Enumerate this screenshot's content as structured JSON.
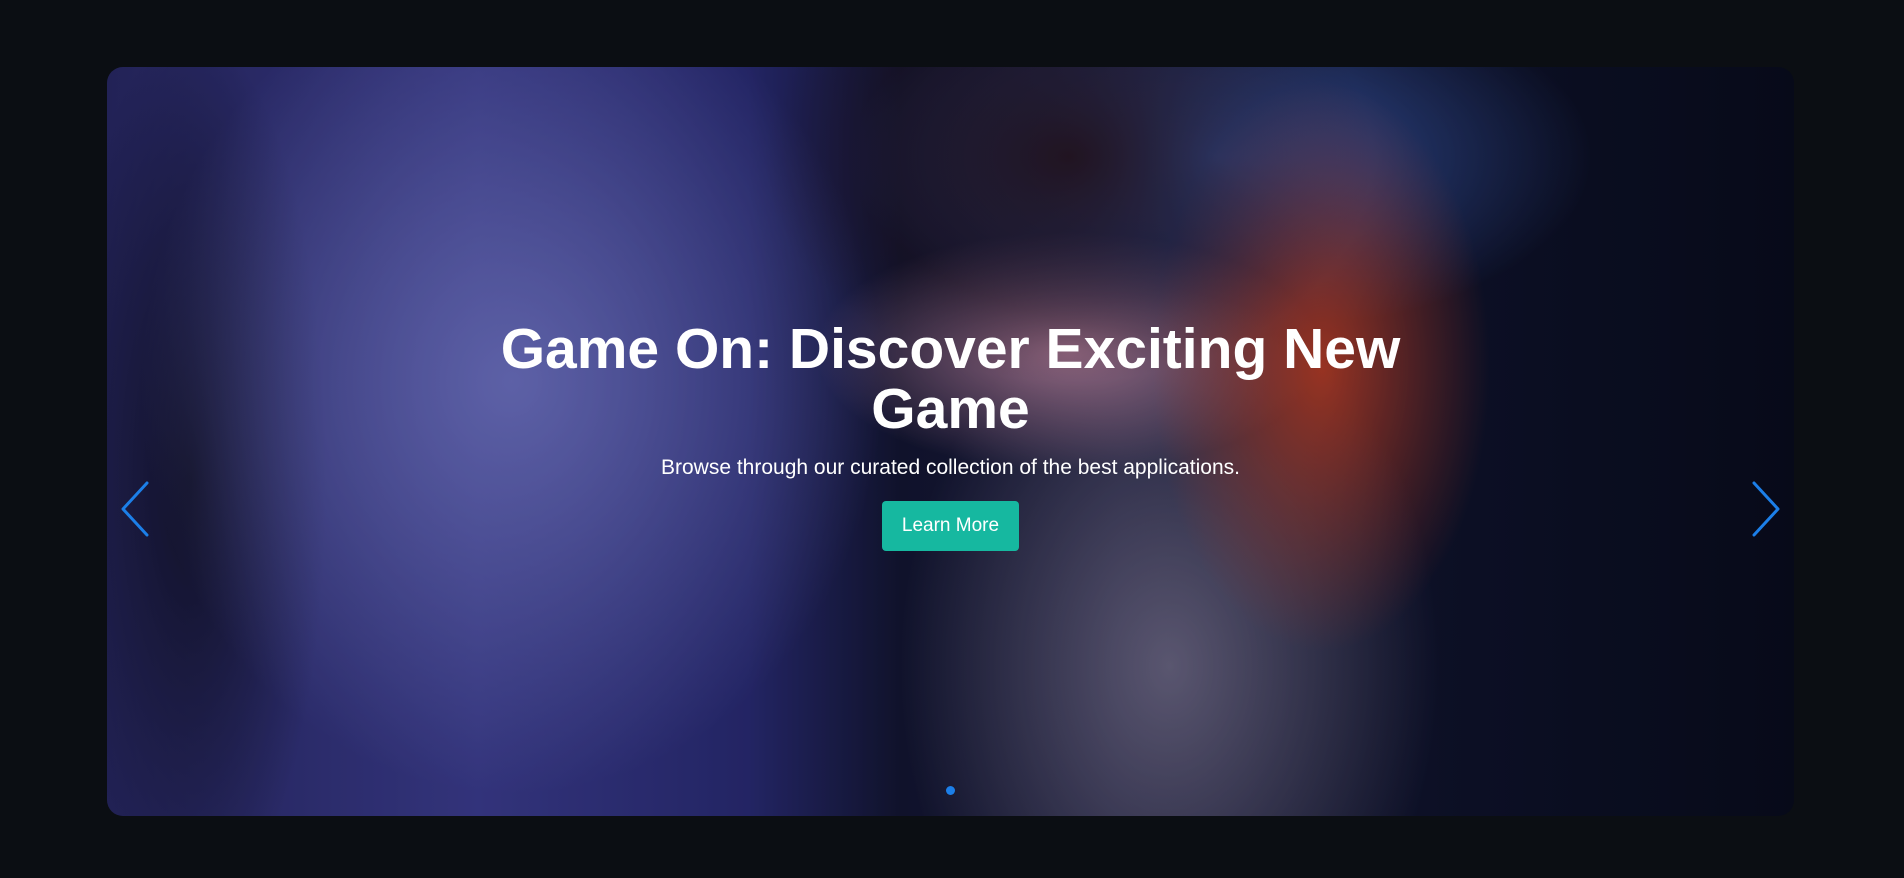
{
  "hero": {
    "title": "Game On: Discover Exciting New Game",
    "subtitle": "Browse through our curated collection of the best applications.",
    "button_label": "Learn More",
    "background_image": "young gamer wearing headphones seated at a computer in a blue-lit gaming room"
  },
  "carousel": {
    "prev_icon": "chevron-left-icon",
    "next_icon": "chevron-right-icon",
    "active_index": 0,
    "dot_count": 1
  },
  "colors": {
    "page_background": "#0b0e13",
    "accent_button": "#16b8a0",
    "arrow": "#1c7fe8",
    "dot_active": "#1c7fe8"
  }
}
